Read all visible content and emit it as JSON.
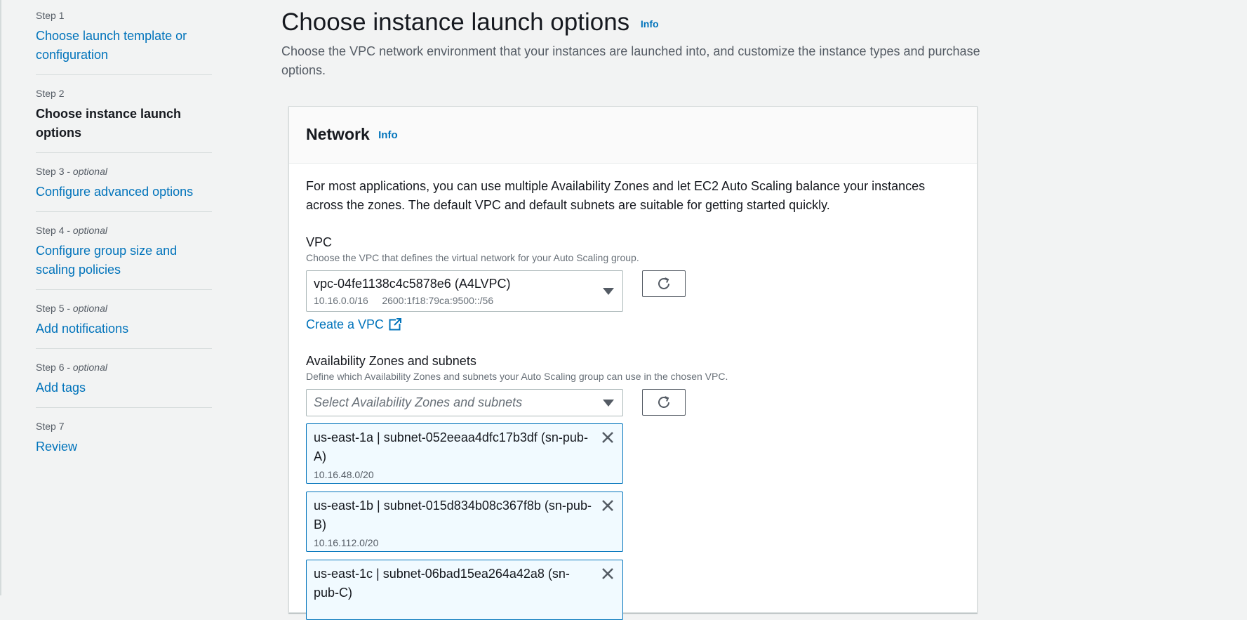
{
  "steps": [
    {
      "num": "Step 1",
      "optional": "",
      "title": "Choose launch template or configuration",
      "current": false
    },
    {
      "num": "Step 2",
      "optional": "",
      "title": "Choose instance launch options",
      "current": true
    },
    {
      "num": "Step 3 - ",
      "optional": "optional",
      "title": "Configure advanced options",
      "current": false
    },
    {
      "num": "Step 4 - ",
      "optional": "optional",
      "title": "Configure group size and scaling policies",
      "current": false
    },
    {
      "num": "Step 5 - ",
      "optional": "optional",
      "title": "Add notifications",
      "current": false
    },
    {
      "num": "Step 6 - ",
      "optional": "optional",
      "title": "Add tags",
      "current": false
    },
    {
      "num": "Step 7",
      "optional": "",
      "title": "Review",
      "current": false
    }
  ],
  "header": {
    "title": "Choose instance launch options",
    "info": "Info",
    "description": "Choose the VPC network environment that your instances are launched into, and customize the instance types and purchase options."
  },
  "network": {
    "title": "Network",
    "info": "Info",
    "intro": "For most applications, you can use multiple Availability Zones and let EC2 Auto Scaling balance your instances across the zones. The default VPC and default subnets are suitable for getting started quickly.",
    "vpc": {
      "label": "VPC",
      "description": "Choose the VPC that defines the virtual network for your Auto Scaling group.",
      "selected": "vpc-04fe1138c4c5878e6 (A4LVPC)",
      "cidr_v4": "10.16.0.0/16",
      "cidr_v6": "2600:1f18:79ca:9500::/56",
      "create_link": "Create a VPC"
    },
    "azs": {
      "label": "Availability Zones and subnets",
      "description": "Define which Availability Zones and subnets your Auto Scaling group can use in the chosen VPC.",
      "placeholder": "Select Availability Zones and subnets",
      "tokens": [
        {
          "name": "us-east-1a | subnet-052eeaa4dfc17b3df (sn-pub-A)",
          "cidr": "10.16.48.0/20"
        },
        {
          "name": "us-east-1b | subnet-015d834b08c367f8b (sn-pub-B)",
          "cidr": "10.16.112.0/20"
        },
        {
          "name": "us-east-1c | subnet-06bad15ea264a42a8 (sn-pub-C)",
          "cidr": ""
        }
      ]
    }
  },
  "colors": {
    "link": "#0073bb",
    "token_bg": "#f1faff",
    "token_border": "#0073bb"
  },
  "icons": {
    "refresh": "refresh-icon",
    "external": "external-link-icon",
    "close": "close-icon",
    "caret": "caret-down-icon"
  }
}
